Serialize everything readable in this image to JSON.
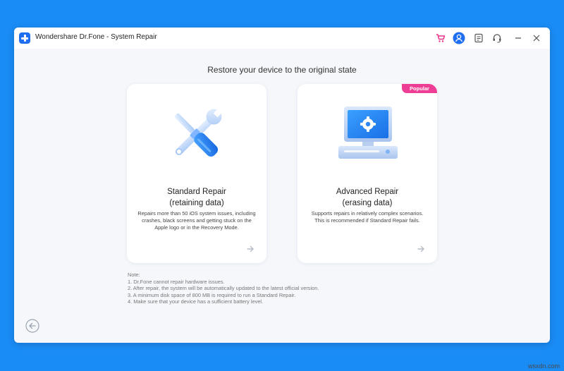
{
  "window": {
    "title": "Wondershare Dr.Fone - System Repair"
  },
  "titlebar_icons": [
    "cart-icon",
    "account-icon",
    "feedback-icon",
    "support-icon",
    "minimize-icon",
    "close-icon"
  ],
  "main": {
    "heading": "Restore your device to the original state",
    "cards": [
      {
        "title_line1": "Standard Repair",
        "title_line2": "(retaining data)",
        "description": "Repairs more than 50 iOS system issues, including crashes, black screens and getting stuck on the Apple logo or in the Recovery Mode.",
        "icon": "tools-icon"
      },
      {
        "title_line1": "Advanced Repair",
        "title_line2": "(erasing data)",
        "description": "Supports repairs in relatively complex scenarios. This is recommended if Standard Repair fails.",
        "badge": "Popular",
        "icon": "computer-settings-icon"
      }
    ]
  },
  "notes": {
    "label": "Note:",
    "items": [
      "1. Dr.Fone cannot repair hardware issues.",
      "2. After repair, the system will be automatically updated to the latest official version.",
      "3. A minimum disk space of 800 MB is required to run a Standard Repair.",
      "4. Make sure that your device has a sufficient battery level."
    ]
  },
  "watermark": "wsxdn.com",
  "colors": {
    "background": "#1a8cf5",
    "accent": "#1f6ff0",
    "badge": "#ee3d94",
    "cart": "#e8338a"
  }
}
